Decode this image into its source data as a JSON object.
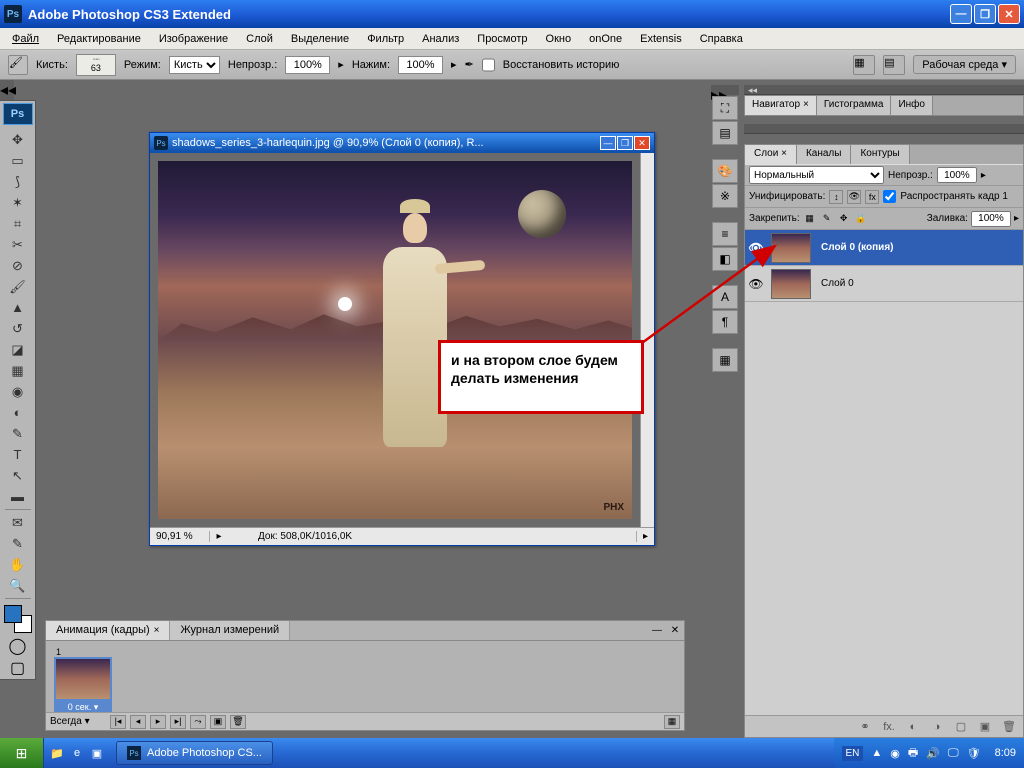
{
  "titlebar": {
    "app_name": "Adobe Photoshop CS3 Extended"
  },
  "menu": [
    "Файл",
    "Редактирование",
    "Изображение",
    "Слой",
    "Выделение",
    "Фильтр",
    "Анализ",
    "Просмотр",
    "Окно",
    "onOne",
    "Extensis",
    "Справка"
  ],
  "options": {
    "brush_label": "Кисть:",
    "brush_size": "63",
    "mode_label": "Режим:",
    "mode_value": "Кисть",
    "opacity_label": "Непрозр.:",
    "opacity_value": "100%",
    "flow_label": "Нажим:",
    "flow_value": "100%",
    "history_cb": "Восстановить историю",
    "workspace": "Рабочая среда"
  },
  "tools": {
    "ps": "Ps"
  },
  "doc": {
    "title": "shadows_series_3-harlequin.jpg @ 90,9% (Слой 0 (копия), R...",
    "zoom": "90,91 %",
    "info": "Док: 508,0K/1016,0K",
    "watermark": "PHX"
  },
  "annotation": {
    "text": "и на втором слое будем делать изменения"
  },
  "nav_tabs": [
    "Навигатор",
    "Гистограмма",
    "Инфо"
  ],
  "layers": {
    "tabs": [
      "Слои",
      "Каналы",
      "Контуры"
    ],
    "blend": "Нормальный",
    "opacity_label": "Непрозр.:",
    "opacity": "100%",
    "unify_label": "Унифицировать:",
    "propagate": "Распространять кадр 1",
    "lock_label": "Закрепить:",
    "fill_label": "Заливка:",
    "fill": "100%",
    "items": [
      {
        "name": "Слой 0 (копия)"
      },
      {
        "name": "Слой 0"
      }
    ]
  },
  "anim": {
    "tabs": [
      "Анимация (кадры)",
      "Журнал измерений"
    ],
    "frame_num": "1",
    "frame_time": "0 сек.",
    "always": "Всегда"
  },
  "taskbar": {
    "app": "Adobe Photoshop CS...",
    "lang": "EN",
    "time": "8:09"
  }
}
